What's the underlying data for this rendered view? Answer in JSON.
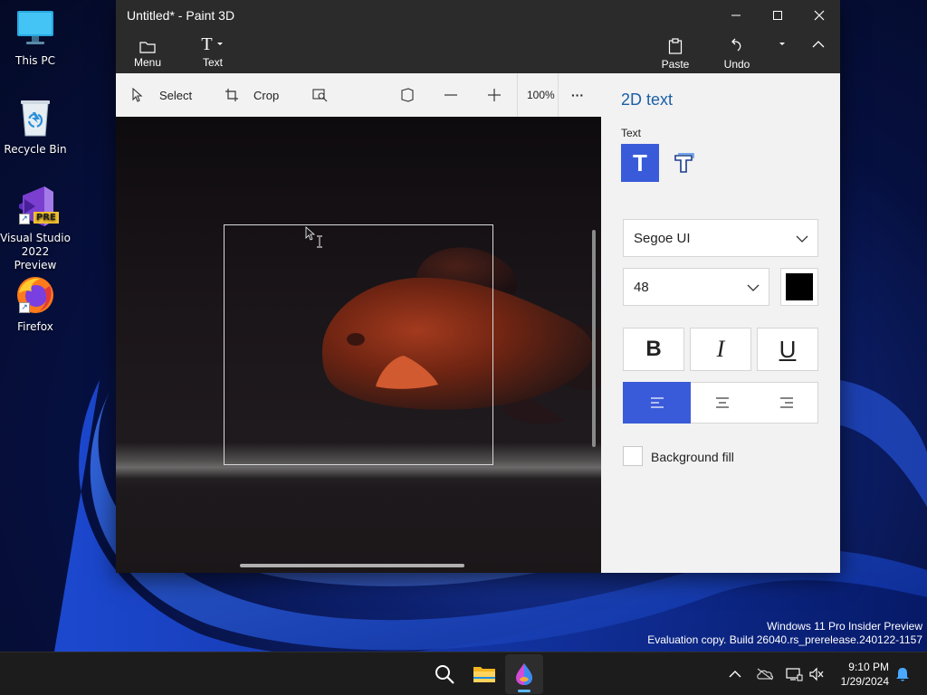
{
  "desktop": {
    "icons": [
      {
        "label": "This PC"
      },
      {
        "label": "Recycle Bin"
      },
      {
        "label": "Visual Studio 2022 Preview",
        "badge": "PRE"
      },
      {
        "label": "Firefox"
      }
    ]
  },
  "window": {
    "title": "Untitled* - Paint 3D",
    "ribbon": {
      "menu_label": "Menu",
      "text_label": "Text",
      "paste_label": "Paste",
      "undo_label": "Undo"
    },
    "toolbar": {
      "select_label": "Select",
      "crop_label": "Crop",
      "zoom_level": "100%",
      "more_label": "···"
    },
    "panel": {
      "title": "2D text",
      "text_section_label": "Text",
      "font_family": "Segoe UI",
      "font_size": "48",
      "text_color": "#000000",
      "bold_label": "B",
      "italic_label": "I",
      "underline_label": "U",
      "alignment_selected": "left",
      "accent_color": "#3a5bd9",
      "background_fill_label": "Background fill",
      "background_fill_checked": false
    }
  },
  "watermark": {
    "line1": "Windows 11 Pro Insider Preview",
    "line2": "Evaluation copy. Build 26040.rs_prerelease.240122-1157"
  },
  "taskbar": {
    "time": "9:10 PM",
    "date": "1/29/2024",
    "icons": [
      "search-icon",
      "file-explorer-icon",
      "paint-3d-icon"
    ],
    "tray_icons": [
      "chevron-up-icon",
      "onedrive-icon",
      "network-icon",
      "volume-muted-icon",
      "notification-bell-icon"
    ]
  }
}
